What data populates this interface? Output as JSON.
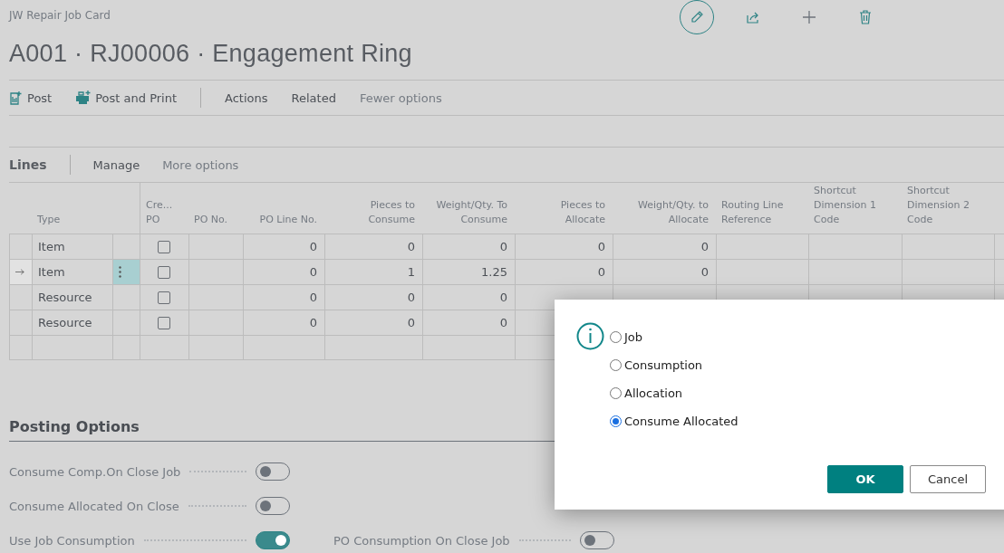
{
  "page": {
    "caption": "JW Repair Job Card",
    "title": "A001 · RJ00006 · Engagement Ring"
  },
  "action_bar": {
    "actions": [
      {
        "kind": "post",
        "label": "Post"
      },
      {
        "kind": "print",
        "label": "Post and Print"
      }
    ],
    "menus": [
      "Actions",
      "Related"
    ],
    "less_link": "Fewer options"
  },
  "lines": {
    "title": "Lines",
    "menus": [
      "Manage"
    ],
    "more_link": "More options",
    "columns": [
      {
        "label": "Type",
        "kind": "text"
      },
      {
        "label": "Cre...\nPO",
        "kind": "check"
      },
      {
        "label": "PO No.",
        "kind": "text"
      },
      {
        "label": "PO Line No.",
        "kind": "number"
      },
      {
        "label": "Pieces to\nConsume",
        "kind": "number"
      },
      {
        "label": "Weight/Qty. To\nConsume",
        "kind": "number"
      },
      {
        "label": "Pieces to\nAllocate",
        "kind": "number"
      },
      {
        "label": "Weight/Qty. to\nAllocate",
        "kind": "number"
      },
      {
        "label": "Routing Line\nReference",
        "kind": "text"
      },
      {
        "label": "Shortcut\nDimension 1\nCode",
        "kind": "text"
      },
      {
        "label": "Shortcut\nDimension 2\nCode",
        "kind": "text"
      }
    ],
    "rows": [
      {
        "selected": false,
        "type": "Item",
        "create_po": false,
        "po_line_no": "0",
        "pieces_to_consume": "0",
        "weight_to_consume": "0",
        "pieces_to_allocate": "0",
        "weight_to_allocate": "0"
      },
      {
        "selected": true,
        "type": "Item",
        "create_po": false,
        "po_line_no": "0",
        "pieces_to_consume": "1",
        "weight_to_consume": "1.25",
        "pieces_to_allocate": "0",
        "weight_to_allocate": "0"
      },
      {
        "selected": false,
        "type": "Resource",
        "create_po": false,
        "po_line_no": "0",
        "pieces_to_consume": "0",
        "weight_to_consume": "0"
      },
      {
        "selected": false,
        "type": "Resource",
        "create_po": false,
        "po_line_no": "0",
        "pieces_to_consume": "0",
        "weight_to_consume": "0"
      }
    ]
  },
  "posting_options": {
    "title": "Posting Options",
    "left": [
      {
        "label": "Consume Comp.On Close Job",
        "on": false
      },
      {
        "label": "Consume Allocated On Close",
        "on": false
      },
      {
        "label": "Use Job Consumption",
        "on": true
      }
    ],
    "right": [
      {
        "label": "PO Consumption On Close Job",
        "on": false
      }
    ]
  },
  "dialog": {
    "options": [
      {
        "label": "Job",
        "selected": false
      },
      {
        "label": "Consumption",
        "selected": false
      },
      {
        "label": "Allocation",
        "selected": false
      },
      {
        "label": "Consume Allocated",
        "selected": true
      }
    ],
    "buttons": [
      {
        "label": "OK",
        "kind": "primary"
      },
      {
        "label": "Cancel",
        "kind": "secondary"
      }
    ]
  }
}
